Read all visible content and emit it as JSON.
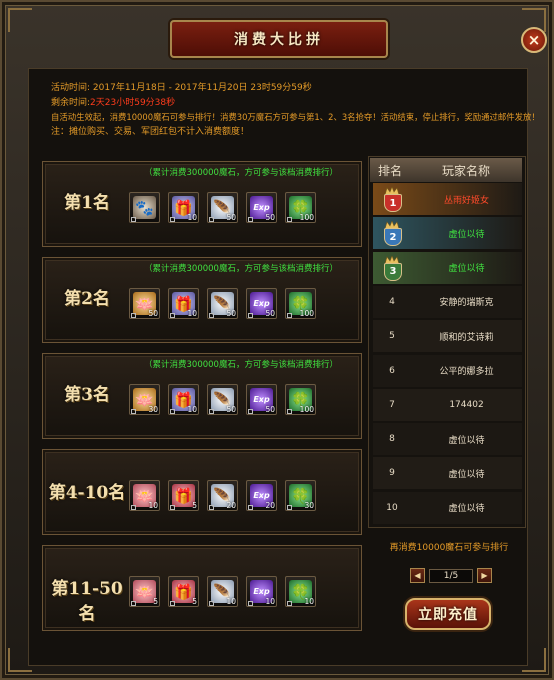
{
  "window": {
    "title": "消费大比拼",
    "close_label": "×"
  },
  "info": {
    "activity_time_label": "活动时间:",
    "activity_time_value": "2017年11月18日  -  2017年11月20日 23时59分59秒",
    "remaining_label": "剩余时间:",
    "remaining_value": "2天23小时59分38秒",
    "rule_line": "自活动生效起，消费10000魔石可参与排行！消费30万魔石方可参与第1、2、3名抢夺！活动结束，停止排行，奖励通过邮件发放！",
    "note_line": "注：摊位购买、交易、军团红包不计入消费额度！"
  },
  "ranks": [
    {
      "title": "第1名",
      "requirement": "（累计消费300000魔石，方可参与该档消费排行）",
      "items": [
        {
          "icon": "fox-pet-icon",
          "count": ""
        },
        {
          "icon": "gift-box-icon",
          "count": "10"
        },
        {
          "icon": "feather-icon",
          "count": "50"
        },
        {
          "icon": "exp-orb-icon",
          "count": "50"
        },
        {
          "icon": "clover-icon",
          "count": "100"
        }
      ]
    },
    {
      "title": "第2名",
      "requirement": "（累计消费300000魔石，方可参与该档消费排行）",
      "items": [
        {
          "icon": "golden-lotus-icon",
          "count": "50"
        },
        {
          "icon": "gift-box-icon",
          "count": "10"
        },
        {
          "icon": "feather-icon",
          "count": "50"
        },
        {
          "icon": "exp-orb-icon",
          "count": "50"
        },
        {
          "icon": "clover-icon",
          "count": "100"
        }
      ]
    },
    {
      "title": "第3名",
      "requirement": "（累计消费300000魔石，方可参与该档消费排行）",
      "items": [
        {
          "icon": "golden-lotus-icon",
          "count": "30"
        },
        {
          "icon": "gift-box-icon",
          "count": "10"
        },
        {
          "icon": "feather-icon",
          "count": "50"
        },
        {
          "icon": "exp-orb-icon",
          "count": "50"
        },
        {
          "icon": "clover-icon",
          "count": "100"
        }
      ]
    },
    {
      "title": "第4-10名",
      "requirement": "",
      "items": [
        {
          "icon": "pink-lotus-icon",
          "count": "10"
        },
        {
          "icon": "red-gift-box-icon",
          "count": "5"
        },
        {
          "icon": "feather-icon",
          "count": "20"
        },
        {
          "icon": "exp-orb-icon",
          "count": "20"
        },
        {
          "icon": "clover-icon",
          "count": "30"
        }
      ]
    },
    {
      "title": "第11-50名",
      "requirement": "",
      "items": [
        {
          "icon": "pink-lotus-icon",
          "count": "5"
        },
        {
          "icon": "red-gift-box-icon",
          "count": "5"
        },
        {
          "icon": "feather-icon",
          "count": "10"
        },
        {
          "icon": "exp-orb-icon",
          "count": "10"
        },
        {
          "icon": "clover-icon",
          "count": "10"
        }
      ]
    }
  ],
  "leaderboard": {
    "header_rank": "排名",
    "header_name": "玩家名称",
    "rows": [
      {
        "rank": "1",
        "name": "丛雨好姬女",
        "medal": "gold"
      },
      {
        "rank": "2",
        "name": "虚位以待",
        "medal": "silver"
      },
      {
        "rank": "3",
        "name": "虚位以待",
        "medal": "bronze"
      },
      {
        "rank": "4",
        "name": "安静的瑞斯克",
        "medal": ""
      },
      {
        "rank": "5",
        "name": "顺和的艾诗莉",
        "medal": ""
      },
      {
        "rank": "6",
        "name": "公平的娜多拉",
        "medal": ""
      },
      {
        "rank": "7",
        "name": "174402",
        "medal": ""
      },
      {
        "rank": "8",
        "name": "虚位以待",
        "medal": ""
      },
      {
        "rank": "9",
        "name": "虚位以待",
        "medal": ""
      },
      {
        "rank": "10",
        "name": "虚位以待",
        "medal": ""
      }
    ],
    "tip": "再消费10000魔石可参与排行",
    "page": "1/5",
    "prev_label": "◀",
    "next_label": "▶"
  },
  "recharge_label": "立即充值",
  "colors": {
    "gold_row": "#7a4a18",
    "silver_row": "#2e5560",
    "bronze_row": "#3d5a32",
    "accent": "#e39a28"
  }
}
